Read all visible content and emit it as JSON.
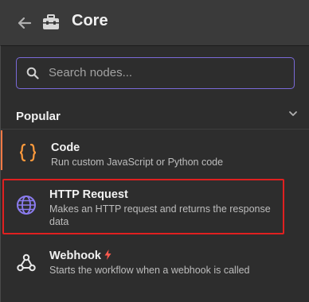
{
  "header": {
    "title": "Core"
  },
  "search": {
    "placeholder": "Search nodes..."
  },
  "section": {
    "title": "Popular"
  },
  "nodes": [
    {
      "title": "Code",
      "description": "Run custom JavaScript or Python code",
      "icon": "code-braces-icon"
    },
    {
      "title": "HTTP Request",
      "description": "Makes an HTTP request and returns the response data",
      "icon": "globe-icon"
    },
    {
      "title": "Webhook",
      "description": "Starts the workflow when a webhook is called",
      "icon": "webhook-icon"
    }
  ],
  "colors": {
    "accent": "#7a6ad8",
    "code_icon": "#ff9a3c",
    "globe_icon": "#8b7cf0",
    "bolt": "#ff5a4e",
    "highlight_border": "#e02020"
  }
}
